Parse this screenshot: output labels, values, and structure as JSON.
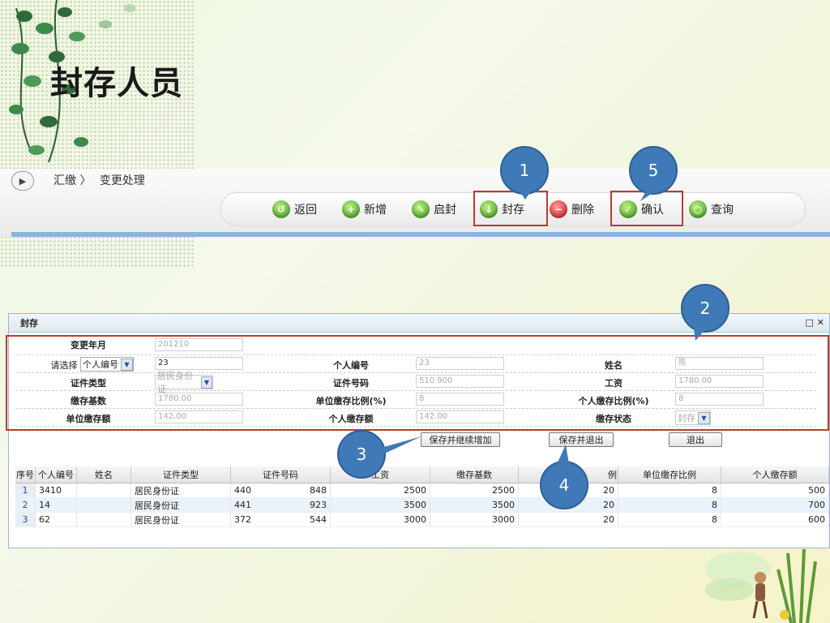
{
  "slide_title": "封存人员",
  "breadcrumb": {
    "root": "汇缴",
    "sep": "〉",
    "page": "变更处理"
  },
  "toolbar": [
    {
      "label": "返回",
      "icon": "back-icon",
      "color": "green"
    },
    {
      "label": "新增",
      "icon": "add-icon",
      "color": "green"
    },
    {
      "label": "启封",
      "icon": "unseal-icon",
      "color": "green"
    },
    {
      "label": "封存",
      "icon": "seal-icon",
      "color": "green"
    },
    {
      "label": "删除",
      "icon": "delete-icon",
      "color": "red"
    },
    {
      "label": "确认",
      "icon": "check-icon",
      "color": "green"
    },
    {
      "label": "查询",
      "icon": "search-icon",
      "color": "green"
    }
  ],
  "callouts": [
    "1",
    "2",
    "3",
    "4",
    "5"
  ],
  "panel": {
    "title": "封存",
    "controls": "□ ✕",
    "form": {
      "change_month": {
        "label": "变更年月",
        "value": "201210"
      },
      "select_label": "请选择",
      "select_value": "个人编号",
      "select_input": "23",
      "person_no": {
        "label": "个人编号",
        "value": "23"
      },
      "name": {
        "label": "姓名",
        "value": "陈"
      },
      "id_type": {
        "label": "证件类型",
        "value": "居民身份证"
      },
      "id_no": {
        "label": "证件号码",
        "value": "510         900"
      },
      "salary": {
        "label": "工资",
        "value": "1780.00"
      },
      "base": {
        "label": "缴存基数",
        "value": "1780.00"
      },
      "unit_ratio": {
        "label": "单位缴存比例(%)",
        "value": "8"
      },
      "personal_ratio": {
        "label": "个人缴存比例(%)",
        "value": "8"
      },
      "unit_amount": {
        "label": "单位缴存额",
        "value": "142.00"
      },
      "personal_amount": {
        "label": "个人缴存额",
        "value": "142.00"
      },
      "status": {
        "label": "缴存状态",
        "value": "封存"
      }
    },
    "buttons": {
      "save_continue": "保存并继续增加",
      "save_exit": "保存并退出",
      "exit": "退出"
    },
    "table": {
      "headers": [
        "序号",
        "个人编号",
        "姓名",
        "证件类型",
        "证件号码",
        "工资",
        "缴存基数",
        "例",
        "单位缴存比例",
        "个人缴存额"
      ],
      "rows": [
        [
          "1",
          "3410",
          "",
          "居民身份证",
          "440",
          "848",
          "2500",
          "2500",
          "20",
          "8",
          "500"
        ],
        [
          "2",
          "14",
          "",
          "居民身份证",
          "441",
          "923",
          "3500",
          "3500",
          "20",
          "8",
          "700"
        ],
        [
          "3",
          "62",
          "",
          "居民身份证",
          "372",
          "544",
          "3000",
          "3000",
          "20",
          "8",
          "600"
        ]
      ]
    }
  }
}
